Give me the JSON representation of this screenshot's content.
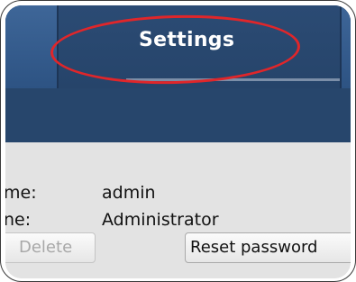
{
  "header": {
    "active_tab_label": "Settings"
  },
  "account": {
    "rows": [
      {
        "label": "me:",
        "value": "admin"
      },
      {
        "label": "ne:",
        "value": "Administrator"
      }
    ]
  },
  "actions": {
    "delete_label": "Delete",
    "reset_password_label": "Reset password"
  },
  "colors": {
    "header_bg": "#27466c",
    "tab_inactive": "#3e6698",
    "content_bg": "#e3e3e3",
    "annotation_red": "#e0262a"
  }
}
